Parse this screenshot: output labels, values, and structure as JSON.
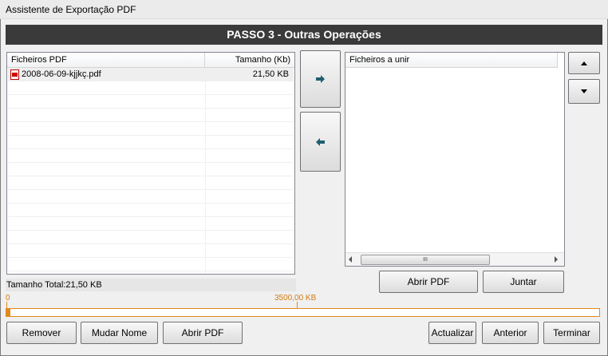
{
  "window": {
    "title": "Assistente de Exportação PDF"
  },
  "banner": {
    "title": "PASSO 3 - Outras Operações"
  },
  "left_list": {
    "columns": [
      "Ficheiros PDF",
      "Tamanho (Kb)"
    ],
    "rows": [
      {
        "name": "2008-06-09-kjjkç.pdf",
        "size": "21,50 KB",
        "icon": "pdf-file-icon"
      }
    ]
  },
  "right_list": {
    "columns": [
      "Ficheiros a unir"
    ],
    "scroll_thumb_glyph": "III"
  },
  "arrows": {
    "add_icon": "arrow-right-icon",
    "remove_icon": "arrow-left-icon",
    "up_icon": "triangle-up-icon",
    "down_icon": "triangle-down-icon"
  },
  "total": {
    "label": "Tamanho Total:21,50 KB"
  },
  "progress": {
    "min_label": "0",
    "max_label": "3500,00 KB",
    "fill_fraction": 0.0061,
    "color": "#e2891e"
  },
  "buttons": {
    "abrir_pdf_right": "Abrir PDF",
    "juntar": "Juntar",
    "remover": "Remover",
    "mudar_nome": "Mudar Nome",
    "abrir_pdf": "Abrir PDF",
    "actualizar": "Actualizar",
    "anterior": "Anterior",
    "terminar": "Terminar"
  }
}
